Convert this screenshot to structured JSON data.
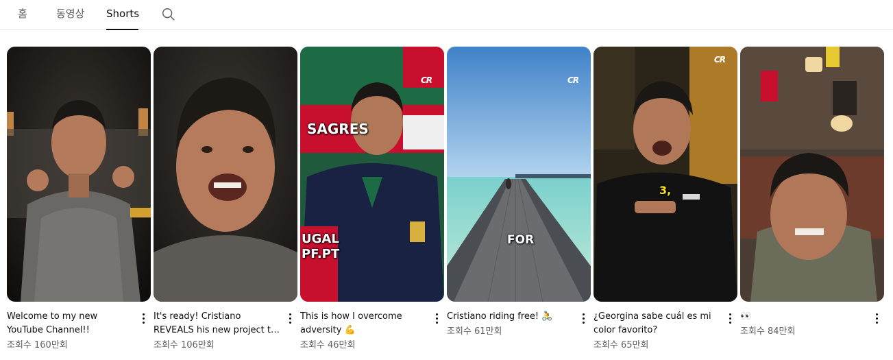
{
  "tabs": {
    "home": "홈",
    "videos": "동영상",
    "shorts": "Shorts"
  },
  "shorts": [
    {
      "title": "Welcome to my new YouTube Channel!!",
      "views": "조회수 160만회"
    },
    {
      "title": "It's ready! Cristiano REVEALS his new project to the entire…",
      "views": "조회수 106만회"
    },
    {
      "title": "This is how I overcome adversity 💪",
      "views": "조회수 46만회"
    },
    {
      "title": "Cristiano riding free! 🚴",
      "views": "조회수 61만회"
    },
    {
      "title": "¿Georgina sabe cuál es mi color favorito?",
      "views": "조회수 65만회"
    },
    {
      "title": "👀",
      "views": "조회수 84만회"
    }
  ],
  "overlay_text": {
    "card3_sign_1": "SAGRES",
    "card3_sign_2": "UGAL",
    "card3_sign_3": "PF.PT",
    "card4_caption": "FOR",
    "card5_caption": "3,",
    "logo": "CR"
  },
  "colors": {
    "text_primary": "#0f0f0f",
    "text_secondary": "#606060",
    "divider": "#e5e5e5",
    "portugal_red": "#c8102e"
  }
}
